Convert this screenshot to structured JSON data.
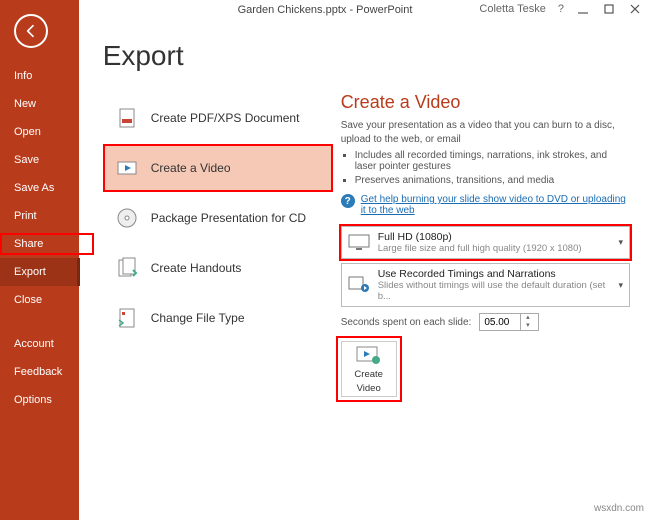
{
  "window": {
    "title": "Garden Chickens.pptx - PowerPoint",
    "user": "Coletta Teske",
    "help": "?"
  },
  "sidebar": {
    "items": [
      {
        "label": "Info"
      },
      {
        "label": "New"
      },
      {
        "label": "Open"
      },
      {
        "label": "Save"
      },
      {
        "label": "Save As"
      },
      {
        "label": "Print"
      },
      {
        "label": "Share"
      },
      {
        "label": "Export",
        "active": true
      },
      {
        "label": "Close"
      }
    ],
    "footer": [
      {
        "label": "Account"
      },
      {
        "label": "Feedback"
      },
      {
        "label": "Options"
      }
    ]
  },
  "page": {
    "title": "Export",
    "options": [
      {
        "label": "Create PDF/XPS Document"
      },
      {
        "label": "Create a Video",
        "selected": true
      },
      {
        "label": "Package Presentation for CD"
      },
      {
        "label": "Create Handouts"
      },
      {
        "label": "Change File Type"
      }
    ]
  },
  "video": {
    "title": "Create a Video",
    "desc": "Save your presentation as a video that you can burn to a disc, upload to the web, or email",
    "bullets": [
      "Includes all recorded timings, narrations, ink strokes, and laser pointer gestures",
      "Preserves animations, transitions, and media"
    ],
    "help_text": "Get help burning your slide show video to DVD or uploading it to the web",
    "quality": {
      "title": "Full HD (1080p)",
      "sub": "Large file size and full high quality (1920 x 1080)"
    },
    "timings": {
      "title": "Use Recorded Timings and Narrations",
      "sub": "Slides without timings will use the default duration (set b..."
    },
    "seconds_label": "Seconds spent on each slide:",
    "seconds_value": "05.00",
    "create_label_1": "Create",
    "create_label_2": "Video"
  },
  "watermark": "wsxdn.com"
}
